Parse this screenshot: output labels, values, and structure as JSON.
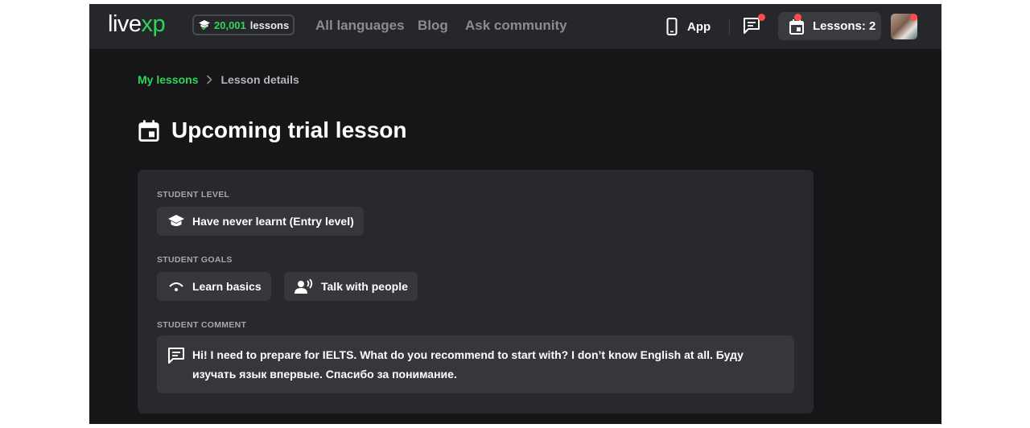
{
  "header": {
    "logo_main": "live",
    "logo_accent": "xp",
    "lessons_count": "20,001",
    "lessons_word": "lessons",
    "nav": [
      "All languages",
      "Blog",
      "Ask community"
    ],
    "app_label": "App",
    "lessons_button": "Lessons: 2"
  },
  "breadcrumb": {
    "parent": "My lessons",
    "separator": ">",
    "current": "Lesson details"
  },
  "page": {
    "title": "Upcoming trial lesson"
  },
  "details": {
    "level_label": "STUDENT LEVEL",
    "level_value": "Have never learnt (Entry level)",
    "goals_label": "STUDENT GOALS",
    "goals": [
      "Learn basics",
      "Talk with people"
    ],
    "comment_label": "STUDENT COMMENT",
    "comment_text": "Hi! I need to prepare for IELTS. What do you recommend to start with? I don’t know English at all. Буду изучать язык впервые. Спасибо за понимание."
  },
  "colors": {
    "accent": "#2fd55b",
    "background": "#161618",
    "header": "#26272a",
    "card": "#28292c",
    "chip": "#36373b",
    "notification": "#ff4b4b"
  }
}
